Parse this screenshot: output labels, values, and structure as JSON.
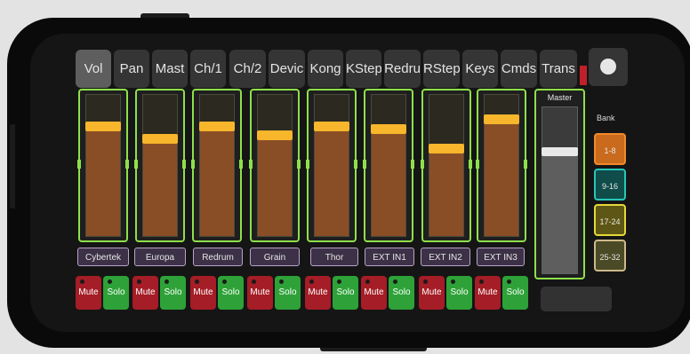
{
  "tabs": [
    {
      "label": "Vol",
      "active": true
    },
    {
      "label": "Pan",
      "active": false
    },
    {
      "label": "Mast",
      "active": false
    },
    {
      "label": "Ch/1",
      "active": false
    },
    {
      "label": "Ch/2",
      "active": false
    },
    {
      "label": "Devic",
      "active": false
    },
    {
      "label": "Kong",
      "active": false
    },
    {
      "label": "KStep",
      "active": false
    },
    {
      "label": "Redru",
      "active": false
    },
    {
      "label": "RStep",
      "active": false
    },
    {
      "label": "Keys",
      "active": false
    },
    {
      "label": "Cmds",
      "active": false
    },
    {
      "label": "Trans",
      "active": false
    }
  ],
  "channels": [
    {
      "name": "Cybertek",
      "level": 0.78,
      "mute_label": "Mute",
      "solo_label": "Solo"
    },
    {
      "name": "Europa",
      "level": 0.69,
      "mute_label": "Mute",
      "solo_label": "Solo"
    },
    {
      "name": "Redrum",
      "level": 0.78,
      "mute_label": "Mute",
      "solo_label": "Solo"
    },
    {
      "name": "Grain",
      "level": 0.72,
      "mute_label": "Mute",
      "solo_label": "Solo"
    },
    {
      "name": "Thor",
      "level": 0.78,
      "mute_label": "Mute",
      "solo_label": "Solo"
    },
    {
      "name": "EXT IN1",
      "level": 0.76,
      "mute_label": "Mute",
      "solo_label": "Solo"
    },
    {
      "name": "EXT IN2",
      "level": 0.62,
      "mute_label": "Mute",
      "solo_label": "Solo"
    },
    {
      "name": "EXT IN3",
      "level": 0.83,
      "mute_label": "Mute",
      "solo_label": "Solo"
    }
  ],
  "master": {
    "label": "Master",
    "level": 0.73
  },
  "bank": {
    "label": "Bank",
    "buttons": [
      {
        "label": "1-8",
        "bg": "#c96a1c",
        "border": "#f08a2c"
      },
      {
        "label": "9-16",
        "bg": "#0f4c4a",
        "border": "#28c7b9"
      },
      {
        "label": "17-24",
        "bg": "#5e5614",
        "border": "#e5d83a"
      },
      {
        "label": "25-32",
        "bg": "#4a4a26",
        "border": "#cdb98b"
      }
    ]
  },
  "colors": {
    "fader_border": "#8ee04a",
    "fader_fill": "#8a4e26",
    "fader_handle": "#f7b62b",
    "mute": "#a51d26",
    "solo": "#2ea238",
    "name_button_bg": "#3c3147"
  }
}
